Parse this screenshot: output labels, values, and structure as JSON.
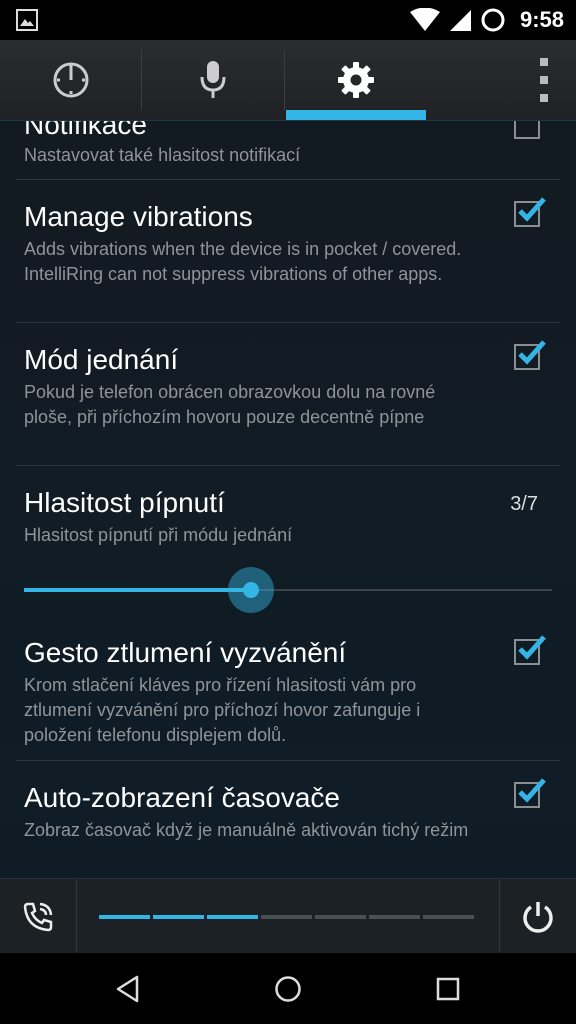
{
  "status_bar": {
    "time": "9:58"
  },
  "tabs": [
    {
      "icon": "timer-icon"
    },
    {
      "icon": "microphone-icon"
    },
    {
      "icon": "gear-icon",
      "selected": true
    }
  ],
  "colors": {
    "accent": "#33b5e5",
    "summary": "#8f9499"
  },
  "preferences": [
    {
      "title": "Notifikace",
      "summary": "Nastavovat také hlasitost notifikací",
      "checked": false
    },
    {
      "title": "Manage vibrations",
      "summary": "Adds vibrations when the device is in pocket / covered. IntelliRing can not suppress vibrations of other apps.",
      "checked": true
    },
    {
      "title": "Mód jednání",
      "summary": "Pokud je telefon obrácen obrazovkou dolu na rovné ploše, při příchozím hovoru pouze decentně pípne",
      "checked": true
    },
    {
      "title": "Hlasitost pípnutí",
      "summary": "Hlasitost pípnutí při módu jednání",
      "value": "3/7",
      "slider_fraction": 0.43
    },
    {
      "title": "Gesto ztlumení vyzvánění",
      "summary": "Krom stlačení kláves pro řízení hlasitosti vám pro ztlumení vyzvánění pro příchozí hovor zafunguje i položení telefonu displejem dolů.",
      "checked": true
    },
    {
      "title": "Auto-zobrazení časovače",
      "summary": "Zobraz časovač když je manuálně aktivován tichý režim",
      "checked": true
    }
  ],
  "bottom_bar": {
    "level_active": 3,
    "level_total": 7
  }
}
